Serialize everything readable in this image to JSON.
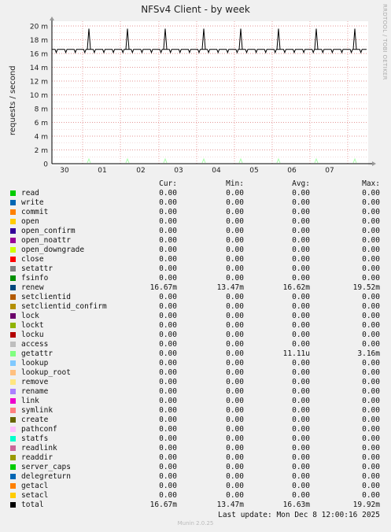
{
  "title": "NFSv4 Client - by week",
  "side_label": "RRDTOOL / TOBI OETIKER",
  "chart_data": {
    "type": "line",
    "title": "NFSv4 Client - by week",
    "ylabel": "requests / second",
    "xlabel": "",
    "ylim": [
      0,
      0.021
    ],
    "y_ticks": [
      "0",
      "2 m",
      "4 m",
      "6 m",
      "8 m",
      "10 m",
      "12 m",
      "14 m",
      "16 m",
      "18 m",
      "20 m"
    ],
    "x_ticks": [
      "30",
      "01",
      "02",
      "03",
      "04",
      "05",
      "06",
      "07"
    ],
    "grid": true,
    "series": [
      {
        "name": "renew",
        "color": "#000000",
        "base": 0.0166,
        "max": 0.0195
      },
      {
        "name": "getattr",
        "color": "#aaffaa",
        "base": 0,
        "max": 3.16e-05
      }
    ]
  },
  "legend": {
    "headers": {
      "cur": "Cur:",
      "min": "Min:",
      "avg": "Avg:",
      "max": "Max:"
    },
    "rows": [
      {
        "name": "read",
        "color": "#00cc00",
        "cur": "0.00",
        "min": "0.00",
        "avg": "0.00",
        "max": "0.00"
      },
      {
        "name": "write",
        "color": "#0066b3",
        "cur": "0.00",
        "min": "0.00",
        "avg": "0.00",
        "max": "0.00"
      },
      {
        "name": "commit",
        "color": "#ff8000",
        "cur": "0.00",
        "min": "0.00",
        "avg": "0.00",
        "max": "0.00"
      },
      {
        "name": "open",
        "color": "#ffcc00",
        "cur": "0.00",
        "min": "0.00",
        "avg": "0.00",
        "max": "0.00"
      },
      {
        "name": "open_confirm",
        "color": "#330099",
        "cur": "0.00",
        "min": "0.00",
        "avg": "0.00",
        "max": "0.00"
      },
      {
        "name": "open_noattr",
        "color": "#990099",
        "cur": "0.00",
        "min": "0.00",
        "avg": "0.00",
        "max": "0.00"
      },
      {
        "name": "open_downgrade",
        "color": "#ccff00",
        "cur": "0.00",
        "min": "0.00",
        "avg": "0.00",
        "max": "0.00"
      },
      {
        "name": "close",
        "color": "#ff0000",
        "cur": "0.00",
        "min": "0.00",
        "avg": "0.00",
        "max": "0.00"
      },
      {
        "name": "setattr",
        "color": "#808080",
        "cur": "0.00",
        "min": "0.00",
        "avg": "0.00",
        "max": "0.00"
      },
      {
        "name": "fsinfo",
        "color": "#008f00",
        "cur": "0.00",
        "min": "0.00",
        "avg": "0.00",
        "max": "0.00"
      },
      {
        "name": "renew",
        "color": "#00487d",
        "cur": "16.67m",
        "min": "13.47m",
        "avg": "16.62m",
        "max": "19.52m"
      },
      {
        "name": "setclientid",
        "color": "#b35a00",
        "cur": "0.00",
        "min": "0.00",
        "avg": "0.00",
        "max": "0.00"
      },
      {
        "name": "setclientid_confirm",
        "color": "#b38f00",
        "cur": "0.00",
        "min": "0.00",
        "avg": "0.00",
        "max": "0.00"
      },
      {
        "name": "lock",
        "color": "#6b006b",
        "cur": "0.00",
        "min": "0.00",
        "avg": "0.00",
        "max": "0.00"
      },
      {
        "name": "lockt",
        "color": "#8fb300",
        "cur": "0.00",
        "min": "0.00",
        "avg": "0.00",
        "max": "0.00"
      },
      {
        "name": "locku",
        "color": "#b30000",
        "cur": "0.00",
        "min": "0.00",
        "avg": "0.00",
        "max": "0.00"
      },
      {
        "name": "access",
        "color": "#bebebe",
        "cur": "0.00",
        "min": "0.00",
        "avg": "0.00",
        "max": "0.00"
      },
      {
        "name": "getattr",
        "color": "#80ff80",
        "cur": "0.00",
        "min": "0.00",
        "avg": "11.11u",
        "max": "3.16m"
      },
      {
        "name": "lookup",
        "color": "#80c9ff",
        "cur": "0.00",
        "min": "0.00",
        "avg": "0.00",
        "max": "0.00"
      },
      {
        "name": "lookup_root",
        "color": "#ffc080",
        "cur": "0.00",
        "min": "0.00",
        "avg": "0.00",
        "max": "0.00"
      },
      {
        "name": "remove",
        "color": "#ffe680",
        "cur": "0.00",
        "min": "0.00",
        "avg": "0.00",
        "max": "0.00"
      },
      {
        "name": "rename",
        "color": "#aa80ff",
        "cur": "0.00",
        "min": "0.00",
        "avg": "0.00",
        "max": "0.00"
      },
      {
        "name": "link",
        "color": "#ee00cc",
        "cur": "0.00",
        "min": "0.00",
        "avg": "0.00",
        "max": "0.00"
      },
      {
        "name": "symlink",
        "color": "#ff8080",
        "cur": "0.00",
        "min": "0.00",
        "avg": "0.00",
        "max": "0.00"
      },
      {
        "name": "create",
        "color": "#666600",
        "cur": "0.00",
        "min": "0.00",
        "avg": "0.00",
        "max": "0.00"
      },
      {
        "name": "pathconf",
        "color": "#ffbfff",
        "cur": "0.00",
        "min": "0.00",
        "avg": "0.00",
        "max": "0.00"
      },
      {
        "name": "statfs",
        "color": "#00ffcc",
        "cur": "0.00",
        "min": "0.00",
        "avg": "0.00",
        "max": "0.00"
      },
      {
        "name": "readlink",
        "color": "#cc6699",
        "cur": "0.00",
        "min": "0.00",
        "avg": "0.00",
        "max": "0.00"
      },
      {
        "name": "readdir",
        "color": "#999900",
        "cur": "0.00",
        "min": "0.00",
        "avg": "0.00",
        "max": "0.00"
      },
      {
        "name": "server_caps",
        "color": "#00cc00",
        "cur": "0.00",
        "min": "0.00",
        "avg": "0.00",
        "max": "0.00"
      },
      {
        "name": "delegreturn",
        "color": "#0066b3",
        "cur": "0.00",
        "min": "0.00",
        "avg": "0.00",
        "max": "0.00"
      },
      {
        "name": "getacl",
        "color": "#ff8000",
        "cur": "0.00",
        "min": "0.00",
        "avg": "0.00",
        "max": "0.00"
      },
      {
        "name": "setacl",
        "color": "#ffcc00",
        "cur": "0.00",
        "min": "0.00",
        "avg": "0.00",
        "max": "0.00"
      },
      {
        "name": "total",
        "color": "#000000",
        "cur": "16.67m",
        "min": "13.47m",
        "avg": "16.63m",
        "max": "19.92m"
      }
    ]
  },
  "last_update": "Last update:  Mon Dec  8 12:00:16 2025",
  "footer": "Munin 2.0.25"
}
